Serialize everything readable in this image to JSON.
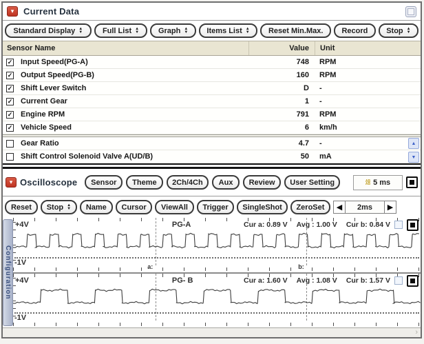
{
  "current_data": {
    "title": "Current Data",
    "toolbar": {
      "standard_display": "Standard Display",
      "full_list": "Full List",
      "graph": "Graph",
      "items_list": "Items List",
      "reset_minmax": "Reset Min.Max.",
      "record": "Record",
      "stop": "Stop"
    },
    "table": {
      "col_name": "Sensor Name",
      "col_value": "Value",
      "col_unit": "Unit",
      "rows": [
        {
          "check": "✓",
          "name": "Input Speed(PG-A)",
          "value": "748",
          "unit": "RPM"
        },
        {
          "check": "✓",
          "name": "Output Speed(PG-B)",
          "value": "160",
          "unit": "RPM"
        },
        {
          "check": "✓",
          "name": "Shift Lever Switch",
          "value": "D",
          "unit": "-"
        },
        {
          "check": "✓",
          "name": "Current Gear",
          "value": "1",
          "unit": "-"
        },
        {
          "check": "✓",
          "name": "Engine RPM",
          "value": "791",
          "unit": "RPM"
        },
        {
          "check": "✓",
          "name": "Vehicle Speed",
          "value": "6",
          "unit": "km/h"
        },
        {
          "check": "",
          "name": "Gear Ratio",
          "value": "4.7",
          "unit": "-"
        },
        {
          "check": "",
          "name": "Shift Control Solenoid Valve A(UD/B)",
          "value": "50",
          "unit": "mA"
        }
      ]
    }
  },
  "oscilloscope": {
    "title": "Oscilloscope",
    "buttons": {
      "sensor": "Sensor",
      "theme": "Theme",
      "ch": "2Ch/4Ch",
      "aux": "Aux",
      "review": "Review",
      "user_setting": "User Setting",
      "reset": "Reset",
      "stop": "Stop",
      "name": "Name",
      "cursor": "Cursor",
      "view_all": "ViewAll",
      "trigger": "Trigger",
      "single_shot": "SingleShot",
      "zero_set": "ZeroSet"
    },
    "timebase": "5 ms",
    "sweep": "2ms",
    "side_tab": "Configuration",
    "cursor_labels": {
      "a": "a:",
      "b": "b:"
    },
    "channels": [
      {
        "top_label": "+4V",
        "name": "PG-A",
        "cur_a": "Cur a: 0.89 V",
        "avg": "Avg : 1.00 V",
        "cur_b": "Cur b: 0.84 V",
        "bottom_label": "-1V",
        "wave": {
          "cycles": 18,
          "duty": 0.4,
          "high": 7,
          "low": 25
        }
      },
      {
        "top_label": "+4V",
        "name": "PG- B",
        "cur_a": "Cur a: 1.60 V",
        "avg": "Avg : 1.08 V",
        "cur_b": "Cur b: 1.57 V",
        "bottom_label": "-1V",
        "wave": {
          "cycles": 7.5,
          "duty": 0.5,
          "high": 7,
          "low": 25
        }
      }
    ]
  }
}
